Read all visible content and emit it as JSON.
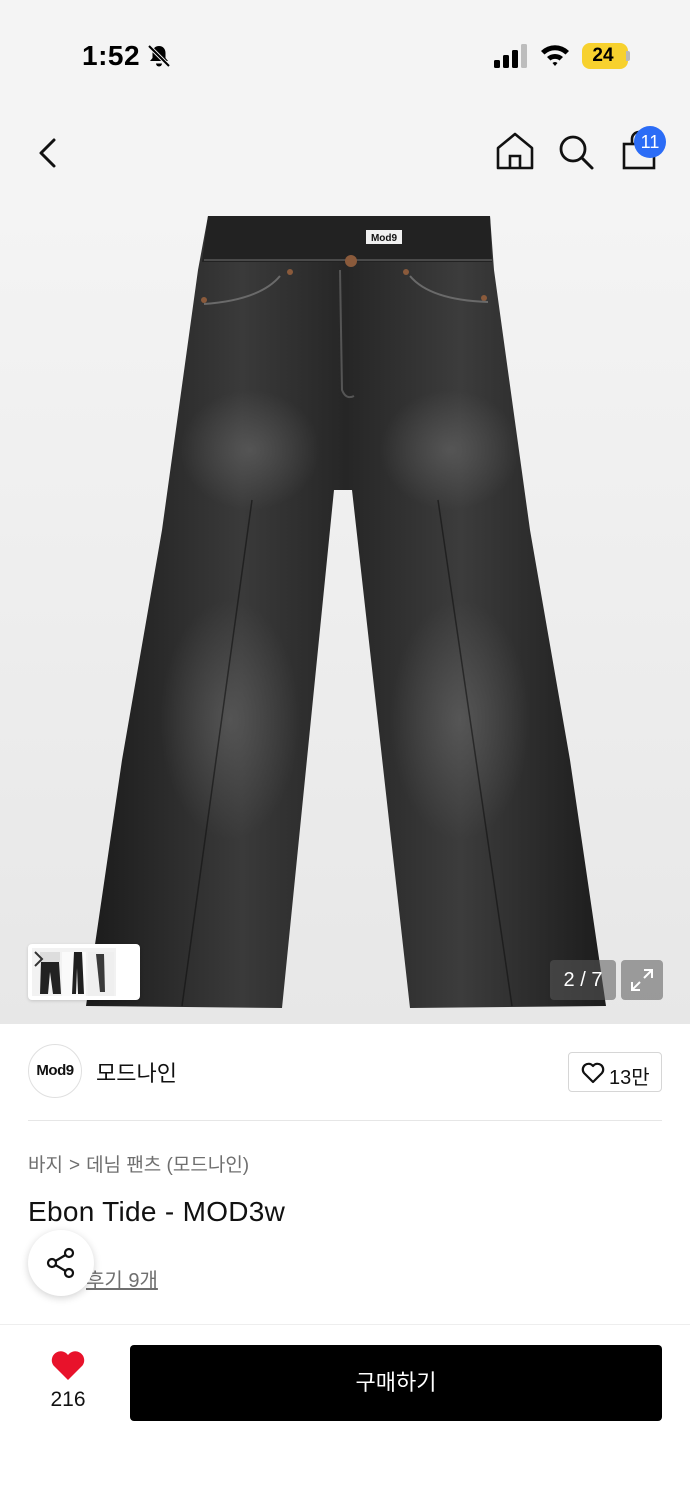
{
  "status_bar": {
    "time": "1:52",
    "battery": "24",
    "icons": [
      "bell-slash-icon",
      "signal-icon",
      "wifi-icon",
      "battery-icon"
    ]
  },
  "top_nav": {
    "icons": [
      "back-icon",
      "home-icon",
      "search-icon",
      "cart-icon"
    ],
    "cart_count": "11"
  },
  "gallery": {
    "image": "black flared denim jeans with Mod9 label",
    "page": "2 / 7",
    "icons": [
      "chevron-right-icon",
      "expand-icon"
    ]
  },
  "brand": {
    "logo_text": "Mod9",
    "name": "모드나인",
    "likes": "13만"
  },
  "product": {
    "breadcrumb": [
      "바지",
      "데님 팬츠 (모드나인)"
    ],
    "breadcrumb_sep": ">",
    "title": "Ebon Tide - MOD3w",
    "review_text": "후기 9개"
  },
  "bottom_bar": {
    "wish_count": "216",
    "buy_label": "구매하기"
  },
  "colors": {
    "accent": "#2b6cf6",
    "heart": "#e8122b",
    "battery": "#f7d12e",
    "buy_button": "#000000"
  }
}
